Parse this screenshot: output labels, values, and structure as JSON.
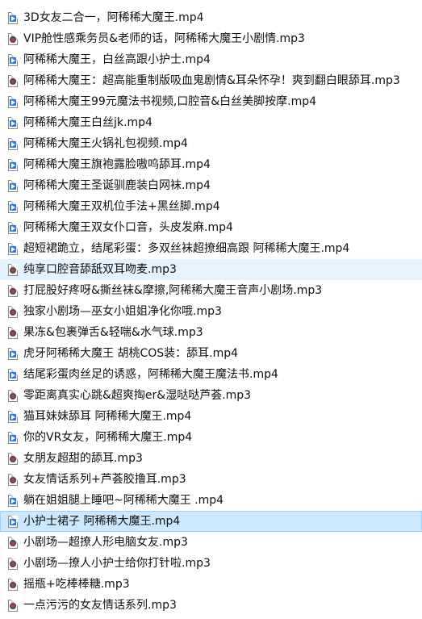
{
  "files": [
    {
      "name": "3D女友二合一，阿稀稀大魔王.mp4",
      "type": "video"
    },
    {
      "name": "VIP舱性感乘务员&老师的话，阿稀稀大魔王小剧情.mp3",
      "type": "audio"
    },
    {
      "name": "阿稀稀大魔王，白丝高跟小护士.mp4",
      "type": "video"
    },
    {
      "name": "阿稀稀大魔王：超高能重制版吸血鬼剧情&耳朵怀孕！爽到翻白眼舔耳.mp3",
      "type": "audio"
    },
    {
      "name": "阿稀稀大魔王99元魔法书视频,口腔音&白丝美脚按摩.mp4",
      "type": "video"
    },
    {
      "name": "阿稀稀大魔王白丝jk.mp4",
      "type": "video"
    },
    {
      "name": "阿稀稀大魔王火锅礼包视频.mp4",
      "type": "video"
    },
    {
      "name": "阿稀稀大魔王旗袍露脸嗷呜舔耳.mp4",
      "type": "video"
    },
    {
      "name": "阿稀稀大魔王圣诞驯鹿装白网袜.mp4",
      "type": "video"
    },
    {
      "name": "阿稀稀大魔王双机位手法+黑丝脚.mp4",
      "type": "video"
    },
    {
      "name": "阿稀稀大魔王双女仆口音，头皮发麻.mp4",
      "type": "video"
    },
    {
      "name": "超短裙跪立，结尾彩蛋：多双丝袜超撩细高跟 阿稀稀大魔王.mp4",
      "type": "video"
    },
    {
      "name": "纯享口腔音舔舐双耳吻麦.mp3",
      "type": "audio",
      "state": "hover"
    },
    {
      "name": "打屁股好疼呀&撕丝袜&摩擦,阿稀稀大魔王音声小剧场.mp3",
      "type": "audio"
    },
    {
      "name": "独家小剧场—巫女小姐姐净化你哦.mp3",
      "type": "audio"
    },
    {
      "name": "果冻&包裹弹舌&轻喘&水气球.mp3",
      "type": "audio"
    },
    {
      "name": "虎牙阿稀稀大魔王 胡桃COS装：舔耳.mp4",
      "type": "video"
    },
    {
      "name": "结尾彩蛋肉丝足的诱惑，阿稀稀大魔王魔法书.mp4",
      "type": "video"
    },
    {
      "name": "零距离真实心跳&超爽掏er&湿哒哒芦荟.mp3",
      "type": "audio"
    },
    {
      "name": "猫耳妹妹舔耳 阿稀稀大魔王.mp4",
      "type": "video"
    },
    {
      "name": "你的VR女友，阿稀稀大魔王.mp4",
      "type": "video"
    },
    {
      "name": "女朋友超甜的舔耳.mp3",
      "type": "audio"
    },
    {
      "name": "女友情话系列+芦荟胶撸耳.mp3",
      "type": "audio"
    },
    {
      "name": "躺在姐姐腿上睡吧~阿稀稀大魔王 .mp4",
      "type": "video"
    },
    {
      "name": "小护士裙子 阿稀稀大魔王.mp4",
      "type": "video",
      "state": "selected"
    },
    {
      "name": "小剧场—超撩人形电脑女友.mp3",
      "type": "audio"
    },
    {
      "name": "小剧场—撩人小护士给你打针啦.mp3",
      "type": "audio"
    },
    {
      "name": "摇瓶+吃棒棒糖.mp3",
      "type": "audio"
    },
    {
      "name": "一点污污的女友情话系列.mp3",
      "type": "audio"
    }
  ]
}
